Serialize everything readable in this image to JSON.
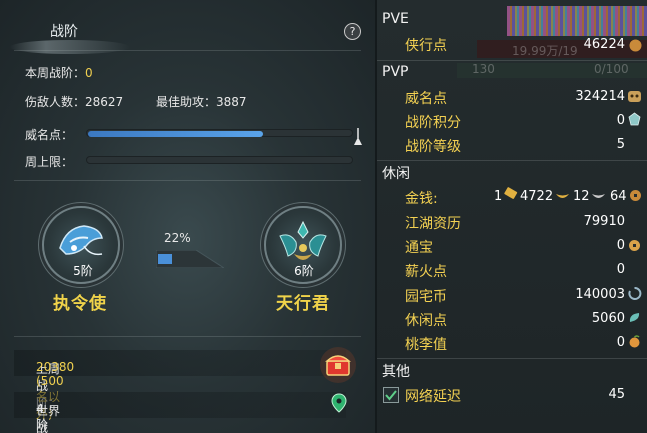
{
  "left": {
    "title": "战阶",
    "help_label": "?",
    "weekly_rank_label": "本周战阶：",
    "weekly_rank_value": "0",
    "kills_label": "伤敌人数：",
    "kills_value": "28627",
    "assist_label": "最佳助攻：",
    "assist_value": "3887",
    "honor_label": "威名点：",
    "honor_fill": 0.66,
    "week_cap_label": "周上限：",
    "week_cap_fill": 0,
    "current_rank_level": "5阶",
    "current_rank_name": "执令使",
    "next_rank_level": "6阶",
    "next_rank_name": "天行君",
    "progress_pct": "22%",
    "last_week_label": "上周战阶：",
    "last_week_value": "20380 (500名以外)",
    "world_rank_label": "世界战阶：",
    "world_rank_value": "4阶"
  },
  "right": {
    "pve_section": "PVE",
    "ghost_text_a": "19.99万/19",
    "ghost_text_b": "130",
    "ghost_text_c": "0/100",
    "xiaxing_label": "侠行点",
    "xiaxing_value": "46224",
    "pvp_section": "PVP",
    "weiming_label": "威名点",
    "weiming_value": "324214",
    "zhanjie_points_label": "战阶积分",
    "zhanjie_points_value": "0",
    "zhanjie_level_label": "战阶等级",
    "zhanjie_level_value": "5",
    "leisure_section": "休闲",
    "money_label": "金钱:",
    "money_gold": "1",
    "money_silver": "4722",
    "money_copper": "12",
    "money_tael": "64",
    "jianghu_label": "江湖资历",
    "jianghu_value": "79910",
    "tongbao_label": "通宝",
    "tongbao_value": "0",
    "xinhuo_label": "薪火点",
    "xinhuo_value": "0",
    "yuanzhai_label": "园宅币",
    "yuanzhai_value": "140003",
    "xiuxian_label": "休闲点",
    "xiuxian_value": "5060",
    "taoli_label": "桃李值",
    "taoli_value": "0",
    "other_section": "其他",
    "latency_label": "网络延迟",
    "latency_value": "45",
    "latency_checked": true
  },
  "colors": {
    "highlight_yellow": "#f0d050",
    "bar_blue": "#4a90d9",
    "panel_bg": "#242c2e"
  }
}
